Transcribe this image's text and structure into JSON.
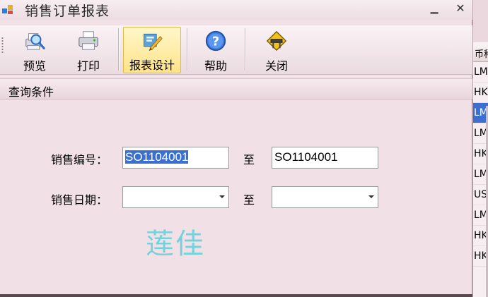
{
  "window": {
    "title": "销售订单报表",
    "minimize_label": "▁",
    "close_label": "✕"
  },
  "toolbar": {
    "items": [
      {
        "label": "预览",
        "icon": "preview-icon"
      },
      {
        "label": "打印",
        "icon": "printer-icon"
      },
      {
        "label": "报表设计",
        "icon": "report-design-icon"
      },
      {
        "label": "帮助",
        "icon": "help-icon"
      },
      {
        "label": "关闭",
        "icon": "exit-icon"
      }
    ]
  },
  "query": {
    "group_title": "查询条件",
    "order_no": {
      "label": "销售编号：",
      "from_value": "SO1104001",
      "to_label": "至",
      "to_value": "SO1104001"
    },
    "order_date": {
      "label": "销售日期：",
      "from_value": "",
      "to_label": "至",
      "to_value": ""
    }
  },
  "watermark": "莲佳",
  "background_window": {
    "column_header": "币种",
    "rows": [
      "LM",
      "HKI",
      "LM",
      "LM",
      "HKI",
      "LM",
      "USI",
      "LM",
      "HKI",
      "HKI"
    ],
    "selected_row_index": 2
  },
  "colors": {
    "selection": "#3a6fd0",
    "active_tool": "#ffe38a",
    "watermark": "#74d2dc"
  }
}
